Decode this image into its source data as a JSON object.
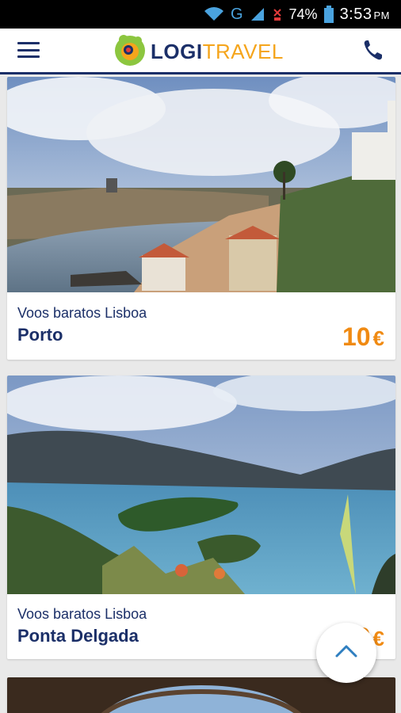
{
  "status_bar": {
    "network": "G",
    "battery": "74%",
    "time": "3:53",
    "ampm": "PM",
    "icons": [
      "wifi-icon",
      "signal-icon",
      "no-signal-icon",
      "battery-icon"
    ]
  },
  "header": {
    "logo_left": "LOGI",
    "logo_right": "TRAVEL",
    "icons": [
      "menu-icon",
      "logo-icon",
      "phone-icon"
    ],
    "colors": {
      "navy": "#1b2f68",
      "orange": "#f5a51c"
    }
  },
  "cards": [
    {
      "subtitle": "Voos baratos Lisboa",
      "title": "Porto",
      "price": "10",
      "currency": "€"
    },
    {
      "subtitle": "Voos baratos Lisboa",
      "title": "Ponta Delgada",
      "price": "10",
      "currency": "€"
    }
  ],
  "scroll_top": {
    "icon": "chevron-up-icon"
  }
}
